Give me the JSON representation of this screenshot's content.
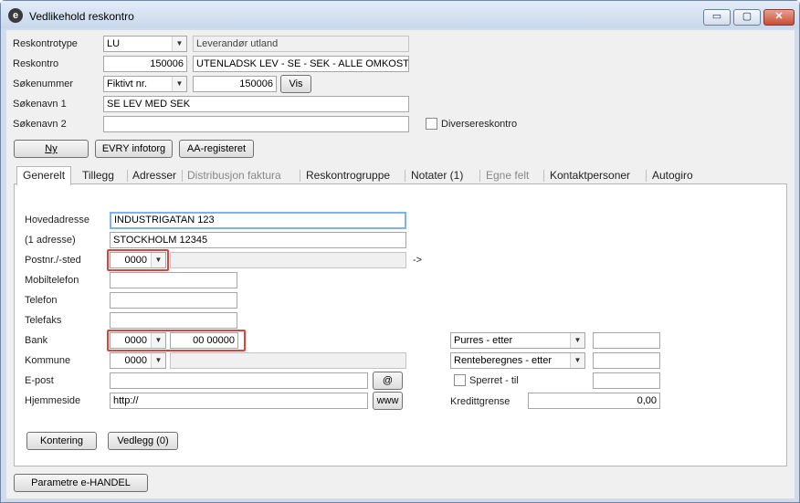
{
  "window": {
    "title": "Vedlikehold reskontro",
    "controls": {
      "minimize": "▭",
      "maximize": "▢",
      "close": "✕"
    }
  },
  "header": {
    "reskontrotype_label": "Reskontrotype",
    "reskontrotype_value": "LU",
    "reskontrotype_desc": "Leverandør utland",
    "reskontro_label": "Reskontro",
    "reskontro_value": "150006",
    "reskontro_name": "UTENLADSK LEV - SE - SEK - ALLE OMKOSTN",
    "sokenummer_label": "Søkenummer",
    "sokenummer_type": "Fiktivt nr.",
    "sokenummer_value": "150006",
    "vis_button": "Vis",
    "sokenavn1_label": "Søkenavn 1",
    "sokenavn1_value": "SE LEV MED SEK",
    "sokenavn2_label": "Søkenavn 2",
    "sokenavn2_value": "",
    "diverse_label": "Diversereskontro",
    "ny_button": "Ny",
    "evry_button": "EVRY infotorg",
    "aa_button": "AA-registeret"
  },
  "tabs": [
    {
      "label": "Generelt",
      "active": true,
      "enabled": true
    },
    {
      "label": "Tillegg",
      "active": false,
      "enabled": true
    },
    {
      "label": "Adresser",
      "active": false,
      "enabled": true
    },
    {
      "label": "Distribusjon faktura",
      "active": false,
      "enabled": false
    },
    {
      "label": "Reskontrogruppe",
      "active": false,
      "enabled": true
    },
    {
      "label": "Notater (1)",
      "active": false,
      "enabled": true
    },
    {
      "label": "Egne felt",
      "active": false,
      "enabled": false
    },
    {
      "label": "Kontaktpersoner",
      "active": false,
      "enabled": true
    },
    {
      "label": "Autogiro",
      "active": false,
      "enabled": true
    }
  ],
  "general": {
    "hovedadresse_label": "Hovedadresse",
    "hovedadresse_value": "INDUSTRIGATAN 123",
    "adresse1_label": "(1 adresse)",
    "adresse1_value": "STOCKHOLM 12345",
    "postnr_label": "Postnr./-sted",
    "postnr_value": "0000",
    "postnr_arrow": "->",
    "mobil_label": "Mobiltelefon",
    "telefon_label": "Telefon",
    "telefaks_label": "Telefaks",
    "bank_label": "Bank",
    "bank_code": "0000",
    "bank_account": "00 00000",
    "kommune_label": "Kommune",
    "kommune_value": "0000",
    "epost_label": "E-post",
    "epost_value": "",
    "epost_button": "@",
    "hjemmeside_label": "Hjemmeside",
    "hjemmeside_value": "http://",
    "www_button": "www",
    "purres_value": "Purres - etter",
    "rente_value": "Renteberegnes - etter",
    "sperret_label": "Sperret  -  til",
    "kredittgrense_label": "Kredittgrense",
    "kredittgrense_value": "0,00",
    "kontering_button": "Kontering",
    "vedlegg_button": "Vedlegg (0)"
  },
  "footer": {
    "parametre_button": "Parametre e-HANDEL"
  },
  "colors": {
    "highlight_box": "#d9453c",
    "focus_border": "#7eb4ea",
    "window_frame": "#cfdcec"
  }
}
